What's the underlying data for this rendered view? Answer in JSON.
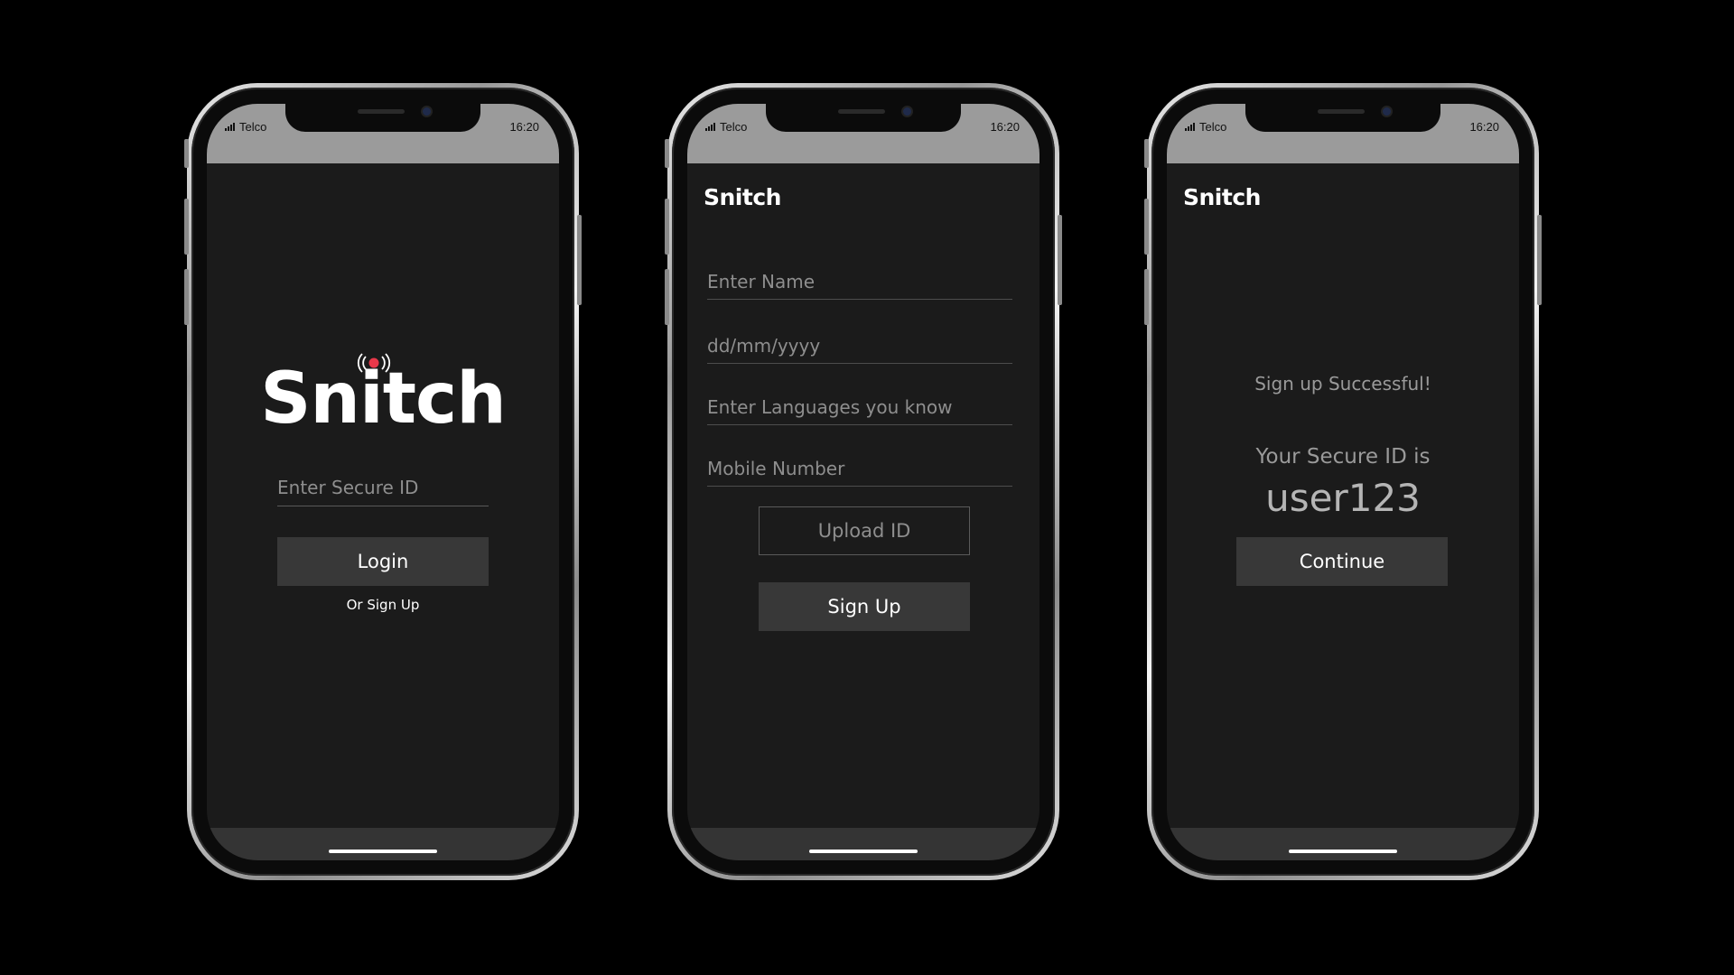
{
  "status_bar": {
    "carrier": "Telco",
    "time": "16:20"
  },
  "login_screen": {
    "logo": "Snitch",
    "secure_id_placeholder": "Enter Secure ID",
    "login_label": "Login",
    "signup_link": "Or Sign Up"
  },
  "signup_screen": {
    "logo": "Snitch",
    "name_placeholder": "Enter Name",
    "dob_placeholder": "dd/mm/yyyy",
    "languages_placeholder": "Enter Languages you know",
    "mobile_placeholder": "Mobile Number",
    "upload_label": "Upload ID",
    "signup_label": "Sign Up"
  },
  "success_screen": {
    "logo": "Snitch",
    "success_message": "Sign up Successful!",
    "secure_id_label": "Your Secure ID is",
    "secure_id_value": "user123",
    "continue_label": "Continue"
  },
  "colors": {
    "accent": "#e8384a",
    "background": "#000000",
    "screen": "#1b1b1b",
    "status_bar": "#9b9b9b",
    "button": "#383838"
  }
}
